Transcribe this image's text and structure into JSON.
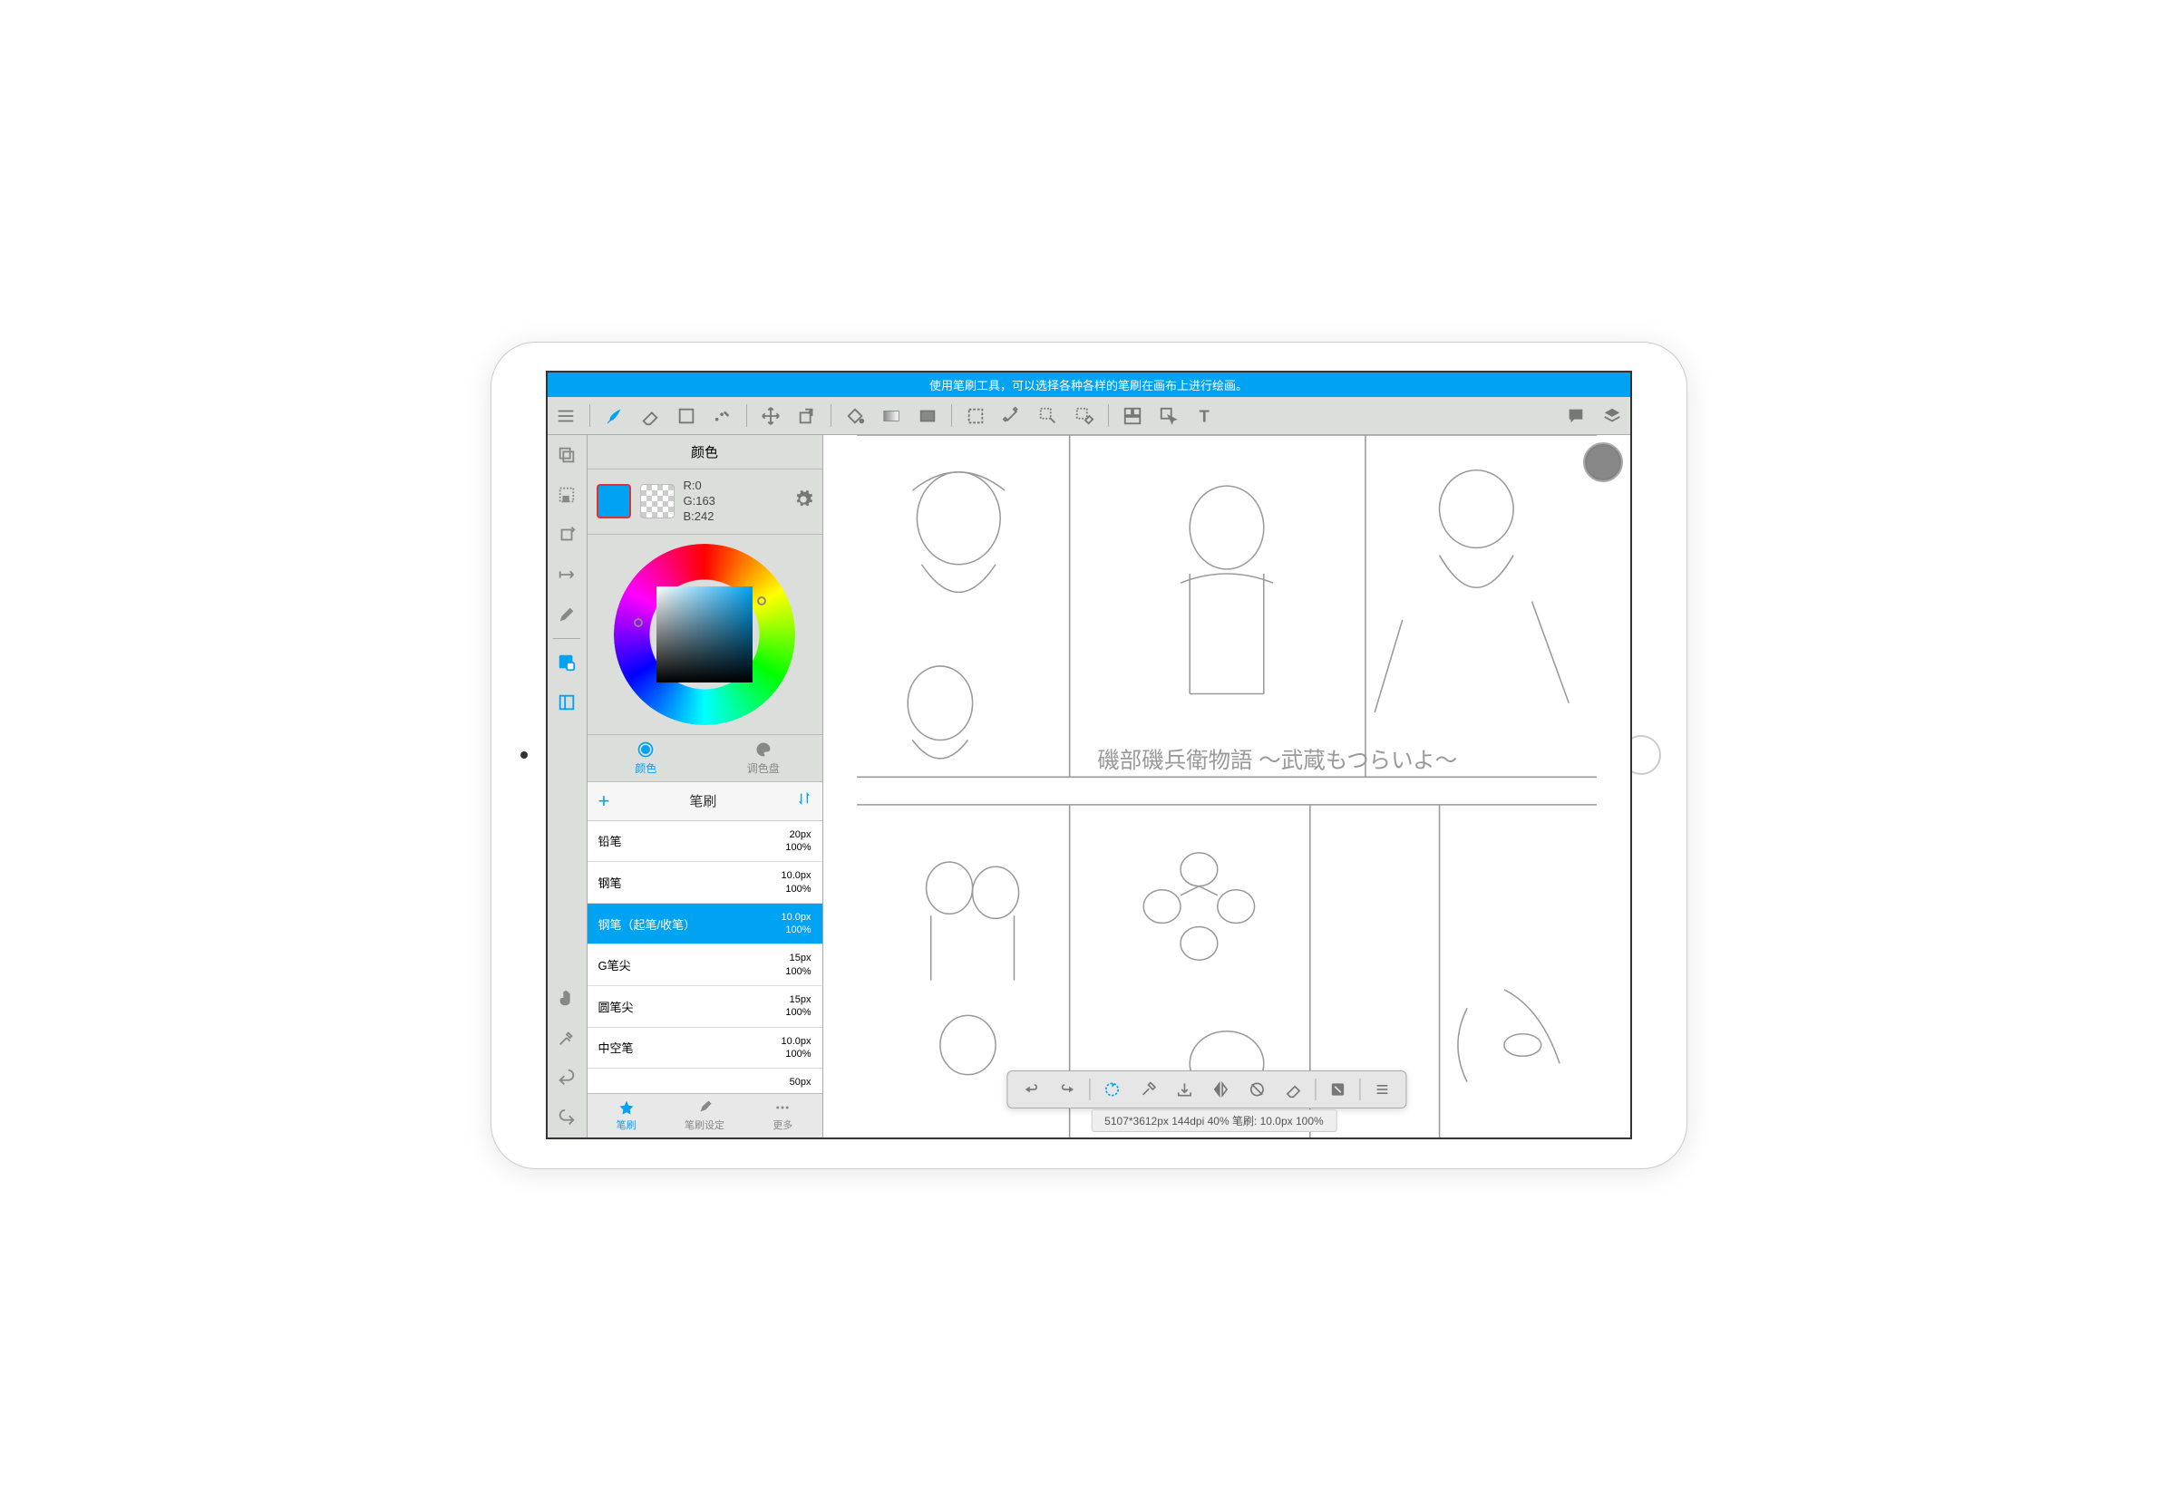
{
  "hint": "使用笔刷工具，可以选择各种各样的笔刷在画布上进行绘画。",
  "toolbar": {
    "groups": [
      [
        "menu"
      ],
      [
        "brush",
        "eraser",
        "shape",
        "fill-gradient"
      ],
      [
        "move-arrows",
        "transform-diagonal"
      ],
      [
        "bucket",
        "gradient",
        "panel-fill"
      ],
      [
        "marquee",
        "wand",
        "pen-select",
        "eraser-select"
      ],
      [
        "grid-panel",
        "pointer",
        "text"
      ]
    ],
    "right": [
      "chat-bubble",
      "layers"
    ]
  },
  "side_rail": {
    "top": [
      "frames",
      "marquee-dots",
      "rotate-cw",
      "ruler-arrow",
      "pencil"
    ],
    "mid": [
      "color-swatch",
      "panel-toggle"
    ],
    "bottom": [
      "hand",
      "eyedropper",
      "undo",
      "redo"
    ]
  },
  "panel": {
    "color_title": "颜色",
    "rgb": {
      "r": "R:0",
      "g": "G:163",
      "b": "B:242"
    },
    "primary_color": "#00a3f2",
    "color_tabs": {
      "color": "颜色",
      "palette": "调色盘"
    },
    "brush_title": "笔刷",
    "brushes": [
      {
        "name": "铅笔",
        "size": "20px",
        "opacity": "100%",
        "selected": false
      },
      {
        "name": "钢笔",
        "size": "10.0px",
        "opacity": "100%",
        "selected": false
      },
      {
        "name": "钢笔（起笔/收笔）",
        "size": "10.0px",
        "opacity": "100%",
        "selected": true
      },
      {
        "name": "G笔尖",
        "size": "15px",
        "opacity": "100%",
        "selected": false
      },
      {
        "name": "圆笔尖",
        "size": "15px",
        "opacity": "100%",
        "selected": false
      },
      {
        "name": "中空笔",
        "size": "10.0px",
        "opacity": "100%",
        "selected": false
      },
      {
        "name": "",
        "size": "50px",
        "opacity": "",
        "selected": false
      }
    ],
    "bottom_tabs": {
      "brush": "笔刷",
      "settings": "笔刷设定",
      "more": "更多"
    }
  },
  "float_toolbar": [
    "undo",
    "redo",
    "sep",
    "rotate-reset",
    "eyedropper",
    "save",
    "flip-horizontal",
    "disable-rotate",
    "clear",
    "sep",
    "fullscreen",
    "sep",
    "menu-lines"
  ],
  "status": "5107*3612px 144dpi 40% 笔刷: 10.0px 100%"
}
